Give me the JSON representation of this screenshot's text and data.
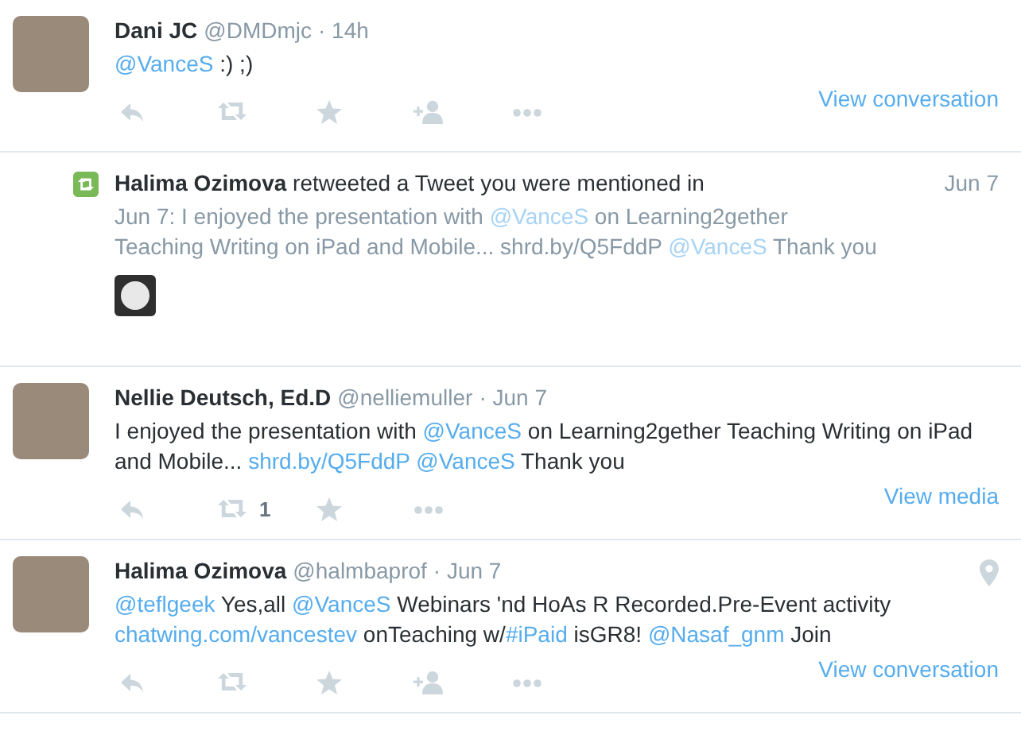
{
  "items": [
    {
      "kind": "tweet",
      "name": "Dani JC",
      "handle": "@DMDmjc",
      "time": "· 14h",
      "location": false,
      "text": [
        {
          "kind": "link",
          "text": "@VanceS"
        },
        {
          "kind": "text",
          "text": " :) ;)"
        }
      ],
      "actions": [
        {
          "kind": "reply"
        },
        {
          "kind": "retweet"
        },
        {
          "kind": "favorite"
        },
        {
          "kind": "follow"
        },
        {
          "kind": "more"
        }
      ],
      "footer_link": "View conversation"
    },
    {
      "kind": "notification",
      "name": "Halima Ozimova",
      "action_text": "retweeted a Tweet you were mentioned in",
      "time": "Jun 7",
      "thumbnail": true,
      "text": [
        {
          "kind": "text",
          "text": "Jun 7: I enjoyed the presentation with "
        },
        {
          "kind": "link",
          "text": "@VanceS"
        },
        {
          "kind": "text",
          "text": " on Learning2gether Teaching Writing on iPad and Mobile... shrd.by/Q5FddP "
        },
        {
          "kind": "link",
          "text": "@VanceS"
        },
        {
          "kind": "text",
          "text": " Thank you"
        }
      ]
    },
    {
      "kind": "tweet",
      "name": "Nellie Deutsch, Ed.D",
      "handle": "@nelliemuller",
      "time": "· Jun 7",
      "location": false,
      "text": [
        {
          "kind": "text",
          "text": "I enjoyed the presentation with "
        },
        {
          "kind": "link",
          "text": "@VanceS"
        },
        {
          "kind": "text",
          "text": " on Learning2gether Teaching Writing on iPad and Mobile... "
        },
        {
          "kind": "link",
          "text": "shrd.by/Q5FddP"
        },
        {
          "kind": "link",
          "text": "@VanceS"
        },
        {
          "kind": "text",
          "text": " Thank you"
        }
      ],
      "actions": [
        {
          "kind": "reply"
        },
        {
          "kind": "retweet",
          "count": "1"
        },
        {
          "kind": "favorite"
        },
        {
          "kind": "more"
        }
      ],
      "footer_link": "View media"
    },
    {
      "kind": "tweet",
      "name": "Halima Ozimova",
      "handle": "@halmbaprof",
      "time": "· Jun 7",
      "location": true,
      "text": [
        {
          "kind": "link",
          "text": "@teflgeek"
        },
        {
          "kind": "text",
          "text": " Yes,all "
        },
        {
          "kind": "link",
          "text": "@VanceS"
        },
        {
          "kind": "text",
          "text": " Webinars 'nd HoAs R Recorded.Pre-Event activity "
        },
        {
          "kind": "link",
          "text": "chatwing.com/vancestev"
        },
        {
          "kind": "text",
          "text": " onTeaching w/"
        },
        {
          "kind": "link",
          "text": "#iPaid"
        },
        {
          "kind": "text",
          "text": " isGR8! "
        },
        {
          "kind": "link",
          "text": "@Nasaf_gnm"
        },
        {
          "kind": "text",
          "text": " Join"
        }
      ],
      "actions": [
        {
          "kind": "reply"
        },
        {
          "kind": "retweet"
        },
        {
          "kind": "favorite"
        },
        {
          "kind": "follow"
        },
        {
          "kind": "more"
        }
      ],
      "footer_link": "View conversation"
    }
  ]
}
